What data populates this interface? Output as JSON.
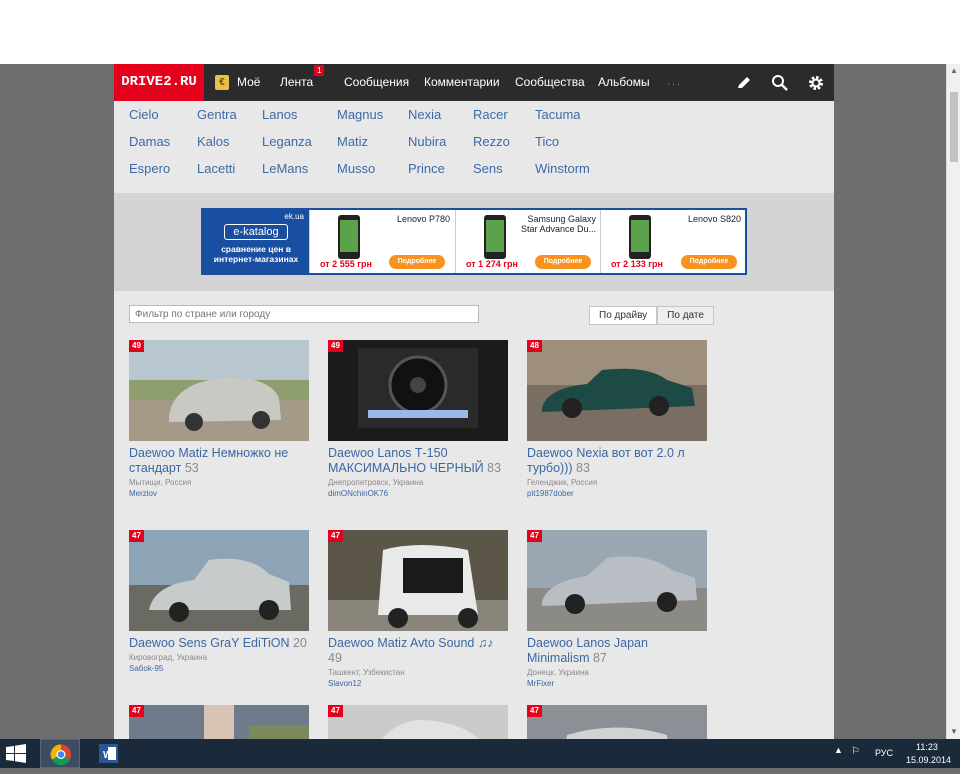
{
  "site": {
    "logo": "DRIVE2.RU",
    "nav": {
      "moe": "Моё",
      "lenta": "Лента",
      "lenta_badge": "1",
      "messages": "Сообщения",
      "comments": "Комментарии",
      "communities": "Сообщества",
      "albums": "Альбомы",
      "more": "..."
    },
    "icons": {
      "edit": "pencil-icon",
      "search": "search-icon",
      "settings": "gear-icon"
    },
    "accent_color": "#e5001b",
    "models": [
      "Cielo",
      "Gentra",
      "Lanos",
      "Magnus",
      "Nexia",
      "Racer",
      "Tacuma",
      "Damas",
      "Kalos",
      "Leganza",
      "Matiz",
      "Nubira",
      "Rezzo",
      "Tico",
      "Espero",
      "Lacetti",
      "LeMans",
      "Musso",
      "Prince",
      "Sens",
      "Winstorm"
    ]
  },
  "ad": {
    "site": "ek.ua",
    "logo": "e-katalog",
    "tagline": "сравнение цен в интернет-магазинах",
    "products": [
      {
        "name": "Lenovo P780",
        "price": "от 2 555 грн",
        "button": "Подробнее"
      },
      {
        "name": "Samsung Galaxy Star Advance Du...",
        "price": "от 1 274 грн",
        "button": "Подробнее"
      },
      {
        "name": "Lenovo S820",
        "price": "от 2 133 грн",
        "button": "Подробнее"
      }
    ]
  },
  "filter": {
    "placeholder": "Фильтр по стране или городу"
  },
  "sort": {
    "by_drive": "По драйву",
    "by_date": "По дате"
  },
  "cards": [
    {
      "badge": "49",
      "title": "Daewoo Matiz Немножко не стандарт",
      "count": "53",
      "location": "Мытищи, Россия",
      "user": "Merzlov"
    },
    {
      "badge": "49",
      "title": "Daewoo Lanos Т-150 МАКСИМАЛЬНО ЧЕРНЫЙ",
      "count": "83",
      "location": "Днепропетровск, Украина",
      "user": "dimONchinOK76"
    },
    {
      "badge": "48",
      "title": "Daewoo Nexia вот вот 2.0 л турбо)))",
      "count": "83",
      "location": "Геленджик, Россия",
      "user": "pit1987dober"
    },
    {
      "badge": "47",
      "title": "Daewoo Sens GraY EdiTiON",
      "count": "20",
      "location": "Кировоград, Украина",
      "user": "Saбok-95"
    },
    {
      "badge": "47",
      "title": "Daewoo Matiz Avto Sound ♫♪",
      "count": "49",
      "location": "Ташкент, Узбекистан",
      "user": "Slavon12"
    },
    {
      "badge": "47",
      "title": "Daewoo Lanos Japan Minimalism",
      "count": "87",
      "location": "Донецк, Украина",
      "user": "MrFixer"
    },
    {
      "badge": "47"
    },
    {
      "badge": "47"
    },
    {
      "badge": "47"
    }
  ],
  "taskbar": {
    "lang": "РУС",
    "time": "11:23",
    "date": "15.09.2014"
  }
}
